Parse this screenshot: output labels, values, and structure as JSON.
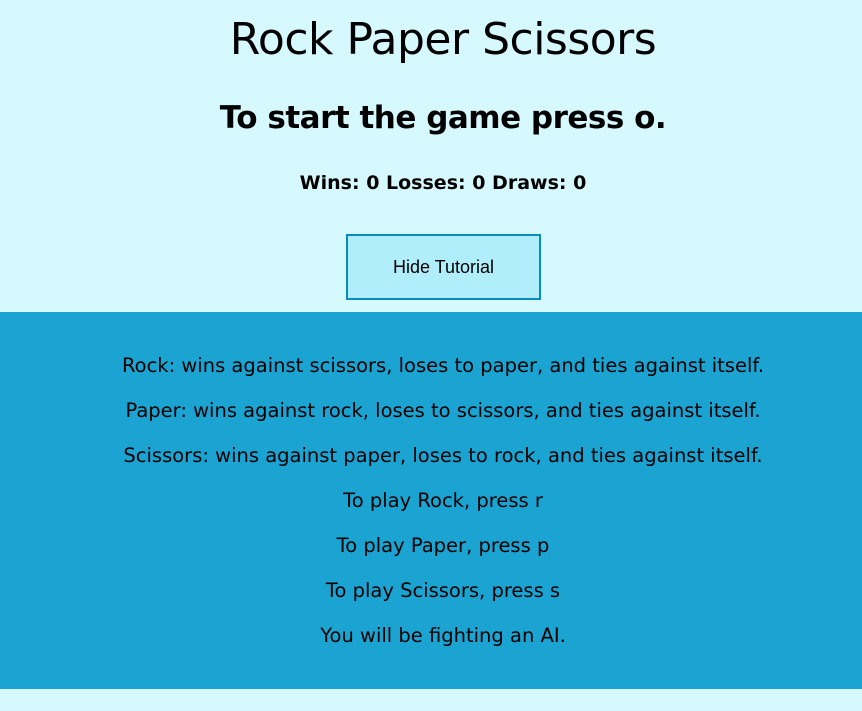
{
  "header": {
    "title": "Rock Paper Scissors",
    "subtitle": "To start the game press o."
  },
  "score": {
    "text": "Wins: 0 Losses: 0 Draws: 0",
    "wins": 0,
    "losses": 0,
    "draws": 0
  },
  "tutorial_button": {
    "label": "Hide Tutorial"
  },
  "tutorial": {
    "lines": [
      "Rock: wins against scissors, loses to paper, and ties against itself.",
      "Paper: wins against rock, loses to scissors, and ties against itself.",
      "Scissors: wins against paper, loses to rock, and ties against itself.",
      "To play Rock, press r",
      "To play Paper, press p",
      "To play Scissors, press s",
      "You will be fighting an AI."
    ]
  },
  "colors": {
    "background": "#d5f9fe",
    "panel": "#1ba3d2",
    "button": "#b0eefc",
    "button_border": "#0a8bbe"
  }
}
